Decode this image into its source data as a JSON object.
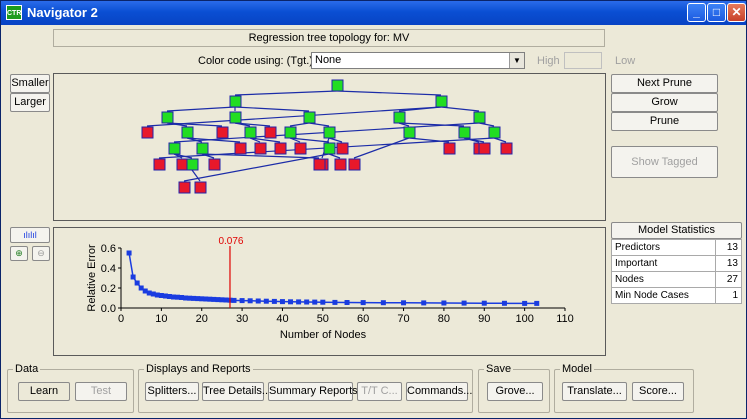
{
  "window": {
    "title": "Navigator 2",
    "icon_text": "CTR",
    "buttons": [
      "_",
      "□",
      "✕"
    ]
  },
  "tree_header": "Regression tree topology for: MV",
  "color_code": {
    "label": "Color code using: (Tgt.) MV",
    "selected": "None",
    "high_label": "High",
    "low_label": "Low"
  },
  "left_buttons": {
    "smaller": "Smaller",
    "larger": "Larger"
  },
  "right_buttons": {
    "next_prune": "Next Prune",
    "grow": "Grow",
    "prune": "Prune",
    "show_tagged": "Show Tagged"
  },
  "model_statistics": {
    "title": "Model Statistics",
    "rows": [
      {
        "label": "Predictors",
        "value": "13"
      },
      {
        "label": "Important",
        "value": "13"
      },
      {
        "label": "Nodes",
        "value": "27"
      },
      {
        "label": "Min Node Cases",
        "value": "1"
      }
    ]
  },
  "colors": {
    "internal_node": "#22dd22",
    "terminal_node": "#e8182a",
    "node_border": "#2222aa",
    "edge": "#1c2ca8",
    "series": "#1a3ce0",
    "marker": "#e00000"
  },
  "chart_data": {
    "type": "line",
    "xlabel": "Number of Nodes",
    "ylabel": "Relative Error",
    "xlim": [
      0,
      110
    ],
    "ylim": [
      0,
      0.6
    ],
    "xticks": [
      0,
      10,
      20,
      30,
      40,
      50,
      60,
      70,
      80,
      90,
      100,
      110
    ],
    "yticks": [
      0.0,
      0.2,
      0.4,
      0.6
    ],
    "marker": {
      "x": 27,
      "label": "0.076"
    },
    "series": [
      {
        "x": [
          2,
          3,
          4,
          5,
          6,
          7,
          8,
          9,
          10,
          11,
          12,
          13,
          14,
          15,
          16,
          17,
          18,
          19,
          20,
          21,
          22,
          23,
          24,
          25,
          26,
          27,
          28,
          30,
          32,
          34,
          36,
          38,
          40,
          42,
          44,
          46,
          48,
          50,
          53,
          56,
          60,
          65,
          70,
          75,
          80,
          85,
          90,
          95,
          100,
          103
        ],
        "values": [
          0.55,
          0.31,
          0.25,
          0.2,
          0.17,
          0.15,
          0.14,
          0.13,
          0.125,
          0.12,
          0.115,
          0.11,
          0.108,
          0.105,
          0.1,
          0.098,
          0.096,
          0.094,
          0.092,
          0.09,
          0.088,
          0.086,
          0.084,
          0.082,
          0.08,
          0.078,
          0.076,
          0.074,
          0.072,
          0.07,
          0.068,
          0.066,
          0.064,
          0.062,
          0.061,
          0.06,
          0.059,
          0.058,
          0.056,
          0.055,
          0.054,
          0.053,
          0.052,
          0.051,
          0.05,
          0.049,
          0.048,
          0.047,
          0.046,
          0.046
        ]
      }
    ]
  },
  "groups": {
    "data": {
      "title": "Data",
      "learn": "Learn",
      "test": "Test"
    },
    "displays": {
      "title": "Displays and Reports",
      "splitters": "Splitters...",
      "tree_details": "Tree Details...",
      "summary": "Summary Reports...",
      "tc": "T/T C...",
      "commands": "Commands..."
    },
    "save": {
      "title": "Save",
      "grove": "Grove..."
    },
    "model": {
      "title": "Model",
      "translate": "Translate...",
      "score": "Score..."
    }
  }
}
